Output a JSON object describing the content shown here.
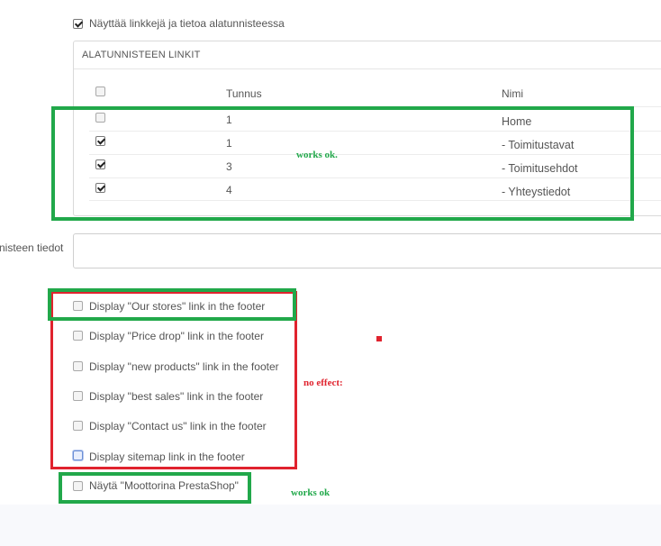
{
  "top_option": {
    "label": "Näyttää linkkejä ja tietoa alatunnisteessa",
    "checked": true
  },
  "links_panel": {
    "title": "ALATUNNISTEEN LINKIT",
    "headers": {
      "id": "Tunnus",
      "name": "Nimi"
    },
    "rows": [
      {
        "id": "1",
        "name": "Home",
        "checked": false
      },
      {
        "id": "1",
        "name": "- Toimitustavat",
        "checked": true
      },
      {
        "id": "3",
        "name": "- Toimitusehdot",
        "checked": true
      },
      {
        "id": "4",
        "name": "- Yhteystiedot",
        "checked": true
      }
    ]
  },
  "footer_info": {
    "label": "nisteen tiedot",
    "value": ""
  },
  "display_options": [
    {
      "label": "Display \"Our stores\" link in the footer",
      "checked": false
    },
    {
      "label": "Display \"Price drop\" link in the footer",
      "checked": false
    },
    {
      "label": "Display \"new products\" link in the footer",
      "checked": false
    },
    {
      "label": "Display \"best sales\" link in the footer",
      "checked": false
    },
    {
      "label": "Display \"Contact us\" link in the footer",
      "checked": false
    },
    {
      "label": "Display sitemap link in the footer",
      "checked": false,
      "focused": true
    },
    {
      "label": "Näytä \"Moottorina PrestaShop\"",
      "checked": false
    }
  ],
  "annotations": {
    "works_ok_1": "works ok.",
    "no_effect": "no effect:",
    "works_ok_2": "works ok"
  },
  "colors": {
    "annotation_green": "#21a84a",
    "annotation_red": "#e0232e"
  }
}
